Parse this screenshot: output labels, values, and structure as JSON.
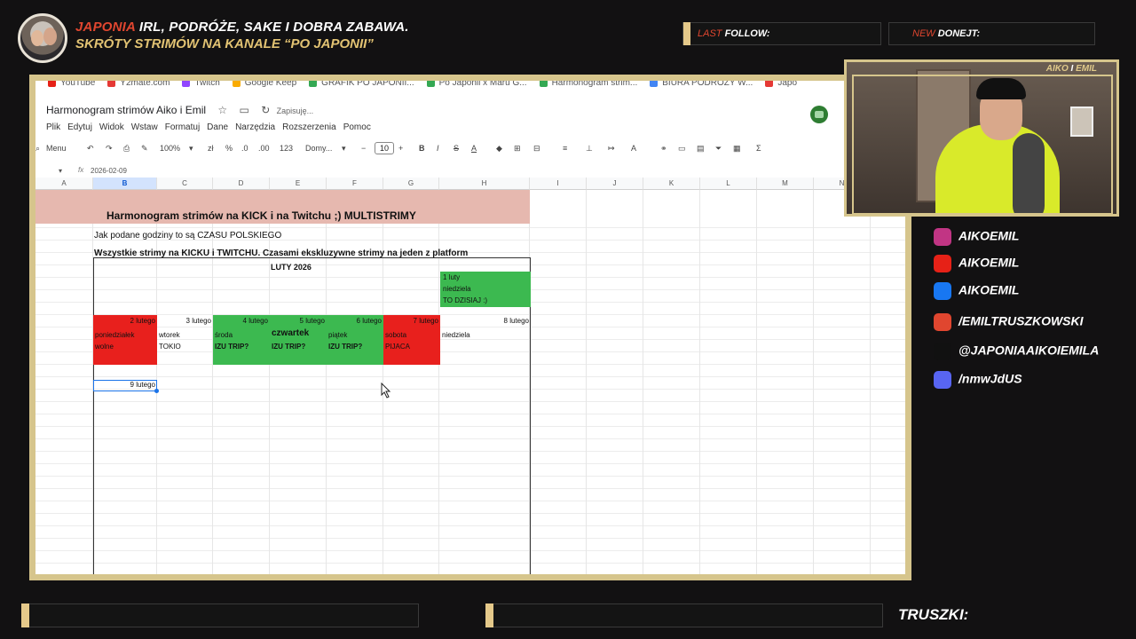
{
  "overlay": {
    "title_highlight": "JAPONIA",
    "title_rest": " IRL, PODRÓŻE, SAKE I DOBRA ZABAWA.",
    "subtitle": "SKRÓTY STRIMÓW NA KANALE “PO JAPONII”",
    "last_follow": {
      "prefix": "LAST ",
      "label": "FOLLOW:"
    },
    "new_donate": {
      "prefix": "NEW ",
      "label": "DONEJT:"
    },
    "cam_label": {
      "a": "AIKO",
      "mid": " I ",
      "b": "EMIL"
    },
    "bottom_label": "TRUSZKI:"
  },
  "socials": [
    {
      "icon": "instagram-icon",
      "color": "#c13584",
      "text": "AIKOEMIL"
    },
    {
      "icon": "youtube-icon",
      "color": "#e62117",
      "text": "AIKOEMIL"
    },
    {
      "icon": "facebook-icon",
      "color": "#1877f2",
      "text": "AIKOEMIL"
    },
    {
      "icon": "fire-icon",
      "color": "#e0462f",
      "text": "/EMILTRUSZKOWSKI"
    },
    {
      "icon": "tiktok-icon",
      "color": "#111111",
      "text": "@JAPONIAAIKOIEMILA"
    },
    {
      "icon": "discord-icon",
      "color": "#5865f2",
      "text": "/nmwJdUS"
    }
  ],
  "bookmarks": [
    {
      "label": "YouTube",
      "color": "#e62117"
    },
    {
      "label": "Y2mate.com",
      "color": "#e53935"
    },
    {
      "label": "Twitch",
      "color": "#9146ff"
    },
    {
      "label": "Google Keep",
      "color": "#f9ab00"
    },
    {
      "label": "GRAFIK PO JAPONII...",
      "color": "#34a853"
    },
    {
      "label": "Po Japonii x Maru G...",
      "color": "#34a853"
    },
    {
      "label": "Harmonogram strim...",
      "color": "#34a853"
    },
    {
      "label": "BIURA PODROŻY W...",
      "color": "#4285f4"
    },
    {
      "label": "Japo",
      "color": "#e53935"
    }
  ],
  "sheet": {
    "doc_title": "Harmonogram strimów Aiko i Emil",
    "saving": "Zapisuję...",
    "menu": [
      "Plik",
      "Edytuj",
      "Widok",
      "Wstaw",
      "Formatuj",
      "Dane",
      "Narzędzia",
      "Rozszerzenia",
      "Pomoc"
    ],
    "toolbar": {
      "menu": "Menu",
      "zoom": "100%",
      "currency": "zł",
      "percent": "%",
      "dec_less": ".0",
      "dec_more": ".00",
      "num": "123",
      "font": "Domy...",
      "size": "10"
    },
    "formula_value": "2026-02-09",
    "columns": [
      "A",
      "B",
      "C",
      "D",
      "E",
      "F",
      "G",
      "H",
      "I",
      "J",
      "K",
      "L",
      "M",
      "N"
    ],
    "selected_column": "B",
    "banner_title": "Harmonogram strimów na KICK  i  na Twitchu ;) MULTISTRIMY",
    "note1": "Jak podane godziny to są CZASU POLSKIEGO",
    "note2": "Wszystkie strimy na KICKU i TWITCHU. Czasami ekskluzywne strimy na jeden z platform",
    "month": "LUTY 2026",
    "feb1": {
      "date": "1 luty",
      "day": "niedziela",
      "note": "TO DZISIAJ :)"
    },
    "week": [
      {
        "date": "2 lutego",
        "day": "poniedziałek",
        "note": "wolne",
        "color": "red"
      },
      {
        "date": "3 lutego",
        "day": "wtorek",
        "note": "TOKIO",
        "color": "none"
      },
      {
        "date": "4 lutego",
        "day": "środa",
        "note": "IZU TRIP?",
        "color": "green"
      },
      {
        "date": "5 lutego",
        "day": "czwartek",
        "note": "IZU TRIP?",
        "color": "green"
      },
      {
        "date": "6 lutego",
        "day": "piątek",
        "note": "IZU TRIP?",
        "color": "green"
      },
      {
        "date": "7 lutego",
        "day": "sobota",
        "note": "PIJACA",
        "color": "red"
      },
      {
        "date": "8 lutego",
        "day": "niedziela",
        "note": "",
        "color": "none"
      }
    ],
    "feb9": "9 lutego"
  }
}
